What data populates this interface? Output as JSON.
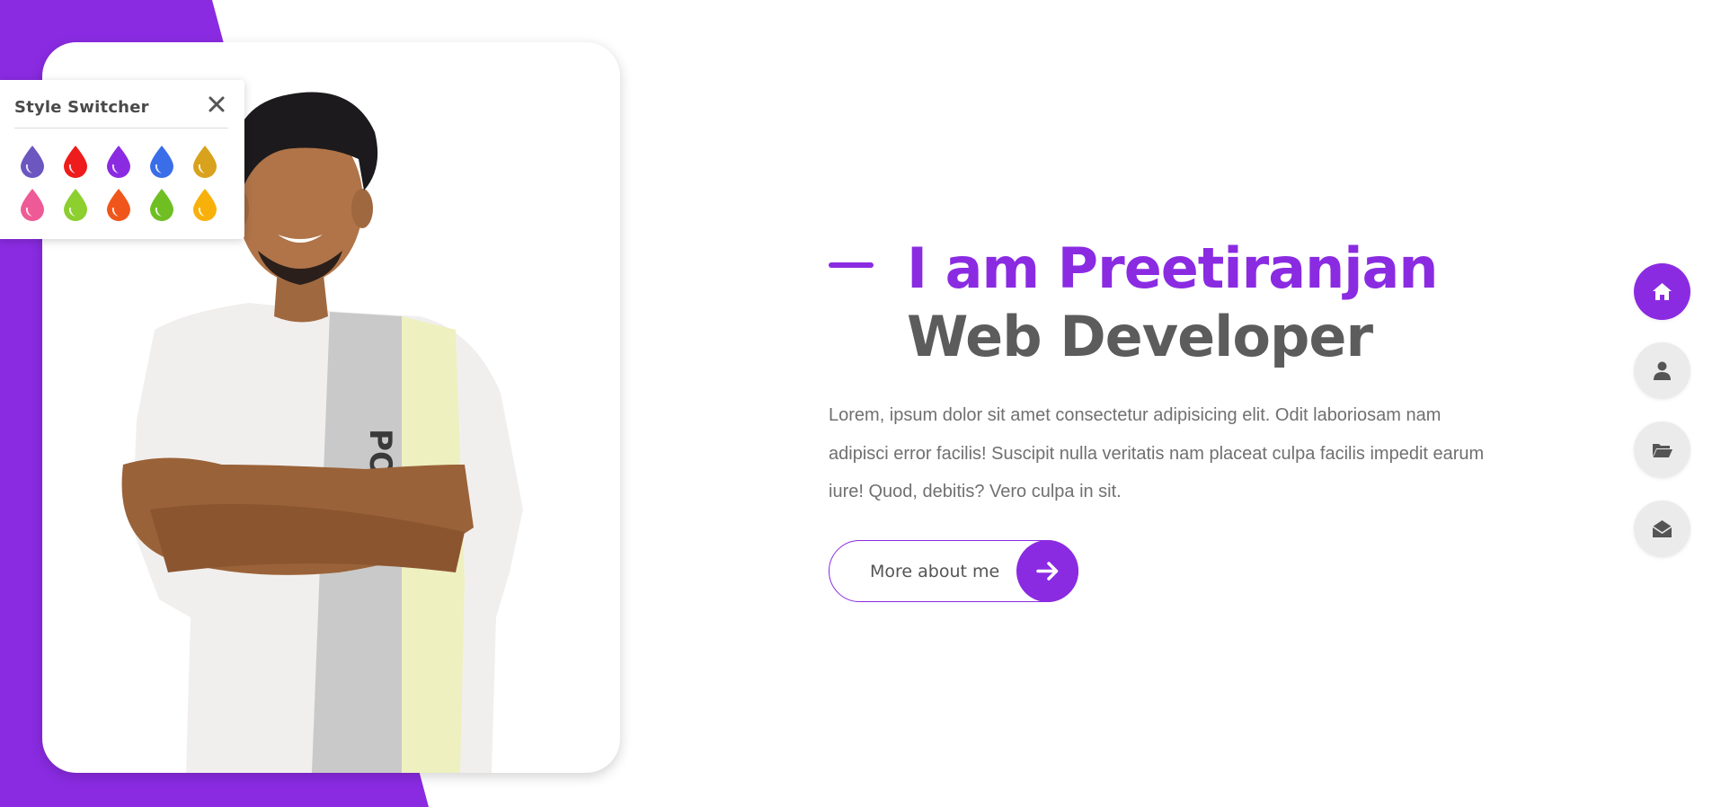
{
  "colors": {
    "accent": "#8a2be2",
    "heading_dark": "#5c5c5c",
    "text": "#707070",
    "nav_inactive": "#ebebeb"
  },
  "style_switcher": {
    "title": "Style Switcher",
    "close_icon": "close-icon",
    "swatches": [
      {
        "name": "color-1",
        "color": "#6c56c0"
      },
      {
        "name": "color-2",
        "color": "#ee1c1c"
      },
      {
        "name": "color-3",
        "color": "#8a2be2"
      },
      {
        "name": "color-4",
        "color": "#3a6ee8"
      },
      {
        "name": "color-5",
        "color": "#d9a21c"
      },
      {
        "name": "color-6",
        "color": "#ee5a95"
      },
      {
        "name": "color-7",
        "color": "#8ccf2f"
      },
      {
        "name": "color-8",
        "color": "#f0561b"
      },
      {
        "name": "color-9",
        "color": "#6fbf23"
      },
      {
        "name": "color-10",
        "color": "#f8b10a"
      }
    ]
  },
  "hero": {
    "greeting": "I am Preetiranjan",
    "role": "Web Developer",
    "description": "Lorem, ipsum dolor sit amet consectetur adipisicing elit. Odit laboriosam nam adipisci error facilis! Suscipit nulla veritatis nam placeat culpa facilis impedit earum iure! Quod, debitis? Vero culpa in sit.",
    "button_label": "More about me",
    "button_icon": "arrow-right-icon"
  },
  "nav": [
    {
      "name": "home",
      "icon": "home-icon",
      "active": true
    },
    {
      "name": "about",
      "icon": "user-icon",
      "active": false
    },
    {
      "name": "portfolio",
      "icon": "folder-icon",
      "active": false
    },
    {
      "name": "contact",
      "icon": "envelope-icon",
      "active": false
    }
  ]
}
